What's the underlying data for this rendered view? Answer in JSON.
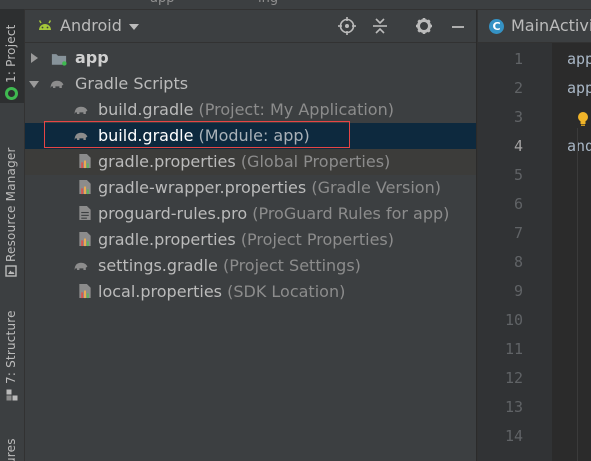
{
  "window": {
    "top_ghost_text": [
      "app",
      "ing"
    ]
  },
  "tool_stripe": {
    "project_tab": "1: Project",
    "resource_tab": "Resource Manager",
    "structure_tab": "7: Structure",
    "favorites_tab": "ures"
  },
  "project_panel": {
    "view_selector": "Android",
    "icons": [
      "android-icon",
      "locate-icon",
      "collapse-all-icon",
      "gear-icon",
      "minimize-icon"
    ]
  },
  "tree": {
    "app": {
      "label": "app"
    },
    "gradle_scripts": {
      "label": "Gradle Scripts"
    },
    "files": [
      {
        "name": "build.gradle",
        "hint": "(Project: My Application)",
        "icon": "gradle-elephant-icon"
      },
      {
        "name": "build.gradle",
        "hint": "(Module: app)",
        "icon": "gradle-elephant-icon"
      },
      {
        "name": "gradle.properties",
        "hint": "(Global Properties)",
        "icon": "properties-file-icon"
      },
      {
        "name": "gradle-wrapper.properties",
        "hint": "(Gradle Version)",
        "icon": "properties-file-icon"
      },
      {
        "name": "proguard-rules.pro",
        "hint": "(ProGuard Rules for app)",
        "icon": "text-file-icon"
      },
      {
        "name": "gradle.properties",
        "hint": "(Project Properties)",
        "icon": "properties-file-icon"
      },
      {
        "name": "settings.gradle",
        "hint": "(Project Settings)",
        "icon": "gradle-elephant-icon"
      },
      {
        "name": "local.properties",
        "hint": "(SDK Location)",
        "icon": "properties-file-icon"
      }
    ]
  },
  "editor": {
    "tab_label": "MainActivi",
    "tab_icon_letter": "C",
    "line_numbers": [
      "1",
      "2",
      "3",
      "4",
      "5",
      "6",
      "7",
      "8",
      "9",
      "10",
      "11",
      "12",
      "13",
      "14"
    ],
    "current_line": "4",
    "code_lines": [
      "app",
      "app",
      "",
      "and"
    ]
  },
  "colors": {
    "selection": "#0d293e",
    "annotation_box": "#e64545",
    "android_green": "#3fb950"
  }
}
